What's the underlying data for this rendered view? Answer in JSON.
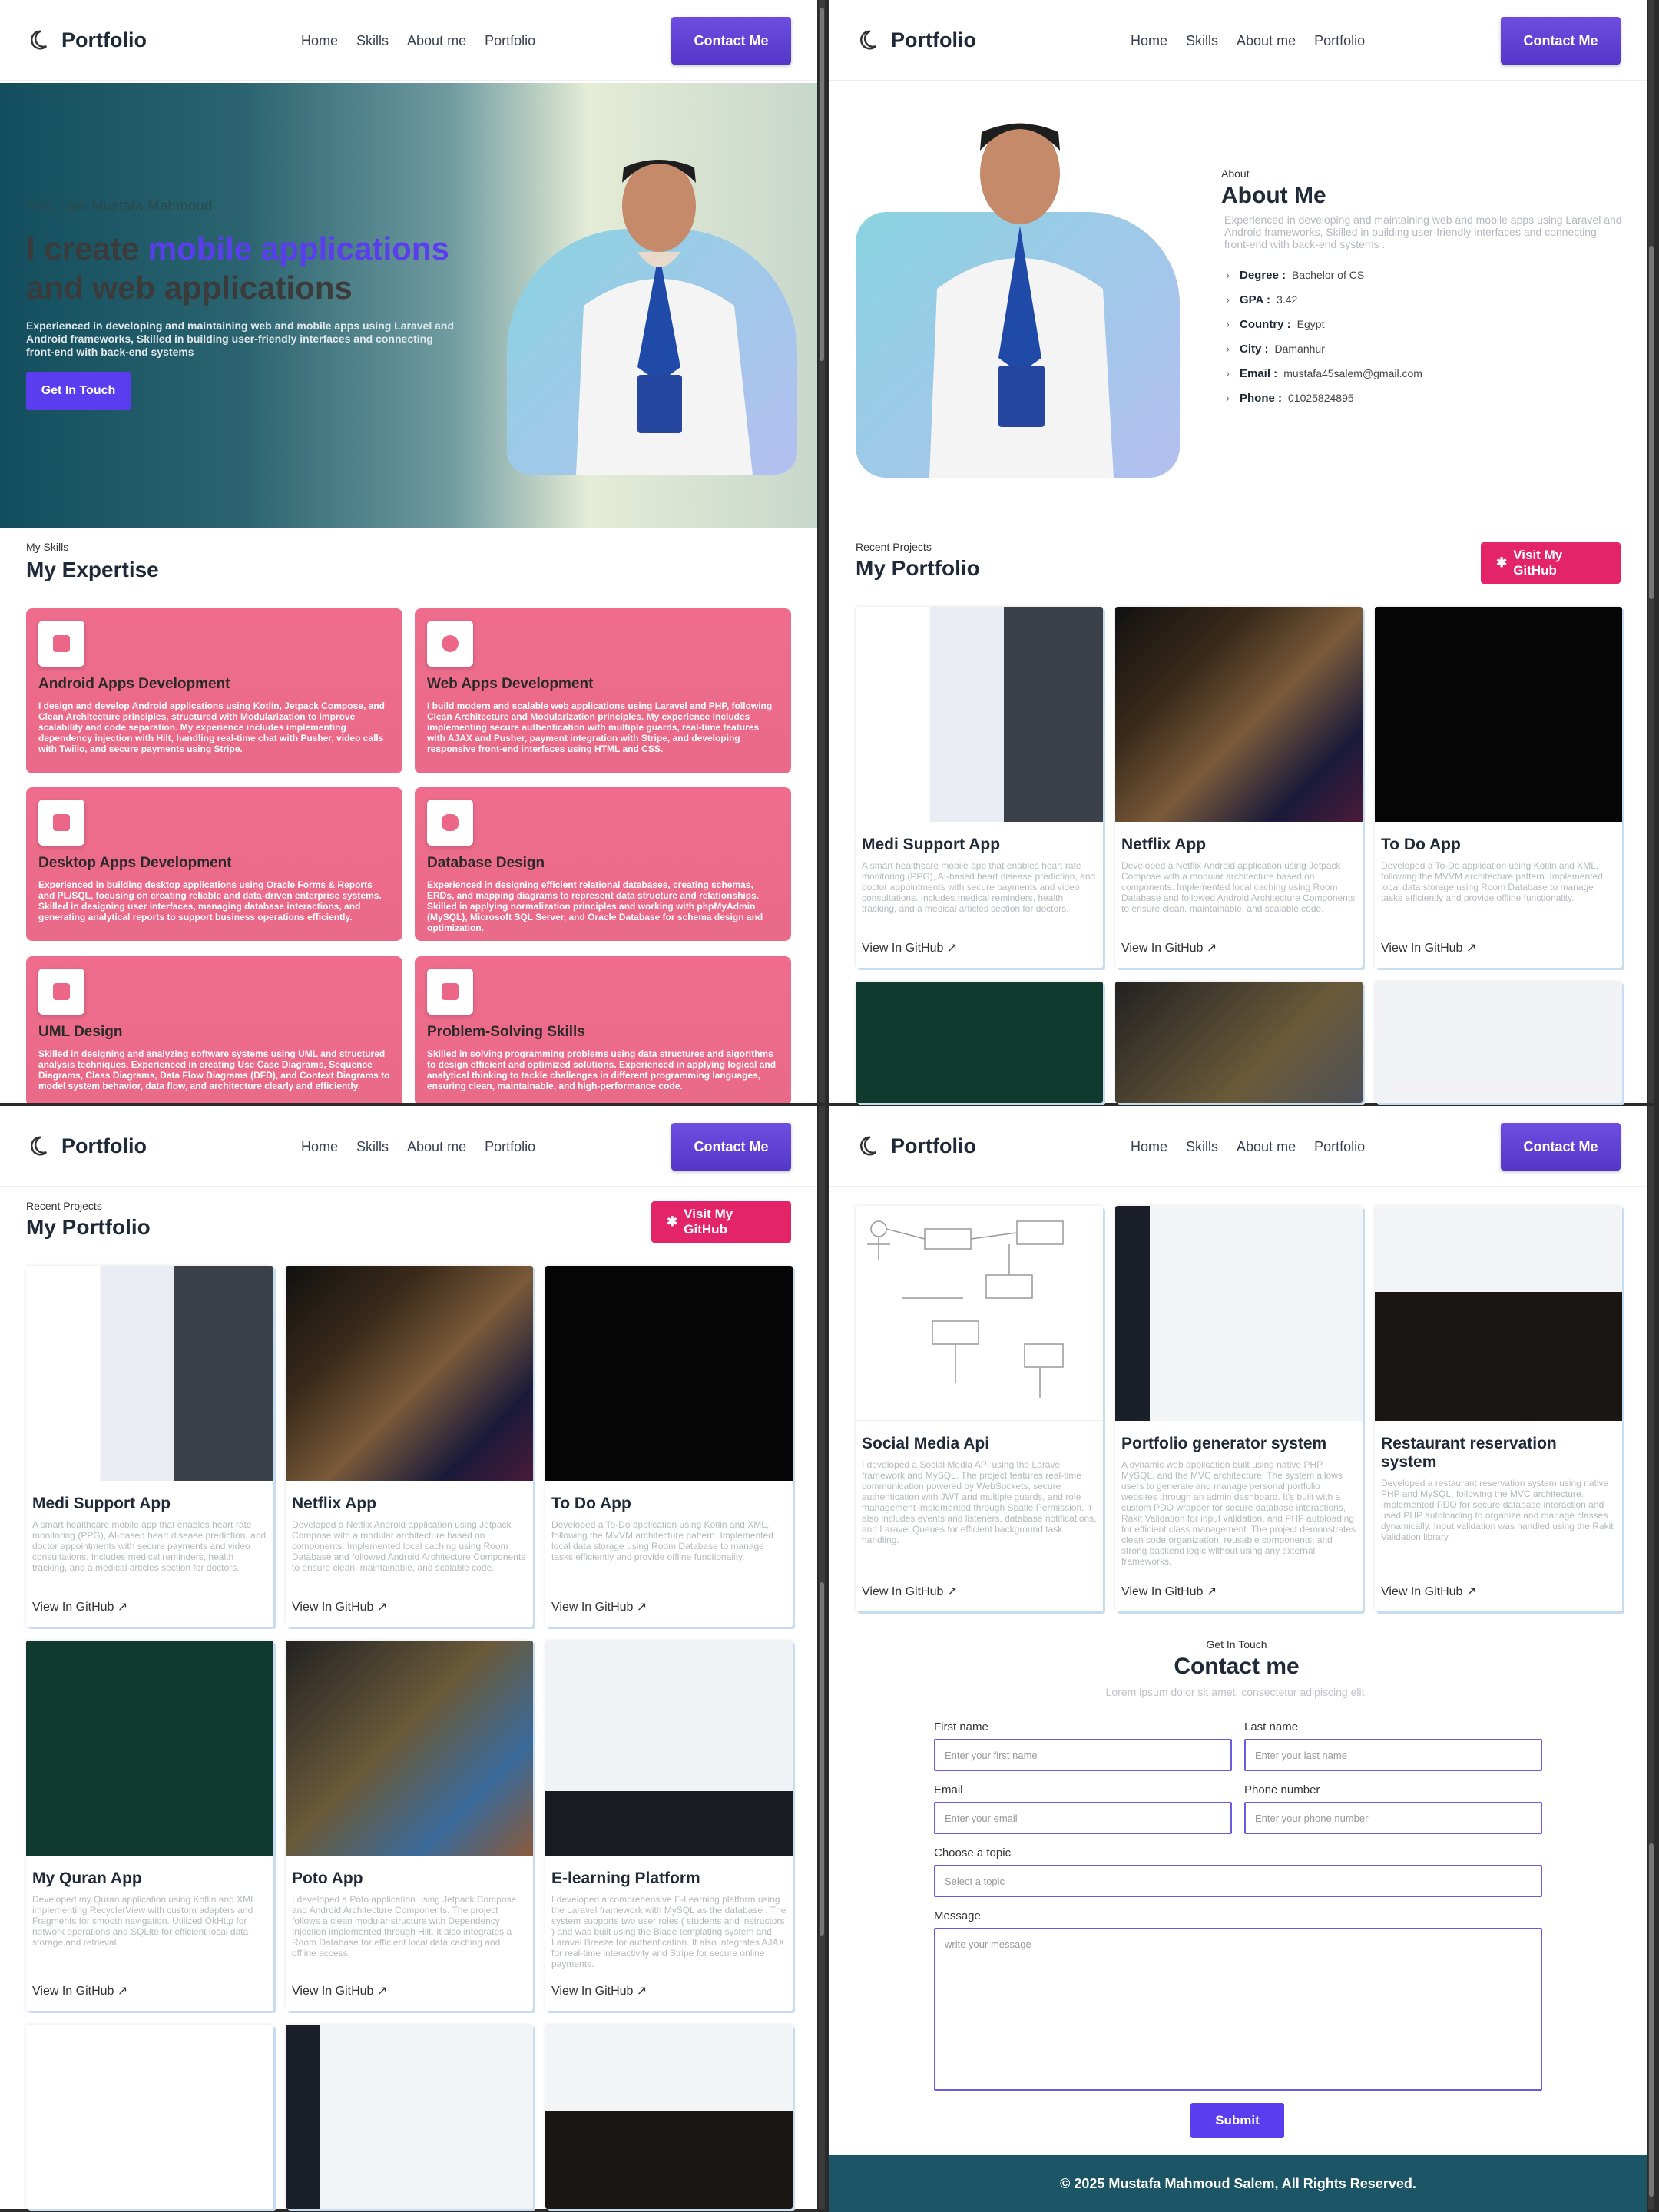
{
  "nav": {
    "brand": "Portfolio",
    "links": [
      "Home",
      "Skills",
      "About me",
      "Portfolio"
    ],
    "contact": "Contact Me"
  },
  "hero": {
    "greeting": "Hey, I am Mustafa Mahmoud",
    "line1": "I create ",
    "accent": "mobile applications",
    "line2": "and web applications",
    "desc": "Experienced in developing and maintaining web and mobile apps using Laravel and Android frameworks, Skilled in building user-friendly interfaces and connecting front-end with back-end systems",
    "cta": "Get In Touch"
  },
  "skills": {
    "eyebrow": "My Skills",
    "title": "My Expertise",
    "items": [
      {
        "title": "Android Apps Development",
        "icon": "mobile-icon",
        "desc": "I design and develop Android applications using Kotlin, Jetpack Compose, and Clean Architecture principles, structured with Modularization to improve scalability and code separation. My experience includes implementing dependency injection with Hilt, handling real-time chat with Pusher, video calls with Twilio, and secure payments using Stripe."
      },
      {
        "title": "Web Apps Development",
        "icon": "globe-icon",
        "desc": "I build modern and scalable web applications using Laravel and PHP, following Clean Architecture and Modularization principles. My experience includes implementing secure authentication with multiple guards, real-time features with AJAX and Pusher, payment integration with Stripe, and developing responsive front-end interfaces using HTML and CSS."
      },
      {
        "title": "Desktop Apps Development",
        "icon": "desktop-icon",
        "desc": "Experienced in building desktop applications using Oracle Forms & Reports and PL/SQL, focusing on creating reliable and data-driven enterprise systems. Skilled in designing user interfaces, managing database interactions, and generating analytical reports to support business operations efficiently."
      },
      {
        "title": "Database Design",
        "icon": "database-icon",
        "desc": "Experienced in designing efficient relational databases, creating schemas, ERDs, and mapping diagrams to represent data structure and relationships. Skilled in applying normalization principles and working with phpMyAdmin (MySQL), Microsoft SQL Server, and Oracle Database for schema design and optimization."
      },
      {
        "title": "UML Design",
        "icon": "diagram-icon",
        "desc": "Skilled in designing and analyzing software systems using UML and structured analysis techniques. Experienced in creating Use Case Diagrams, Sequence Diagrams, Class Diagrams, Data Flow Diagrams (DFD), and Context Diagrams to model system behavior, data flow, and architecture clearly and efficiently."
      },
      {
        "title": "Problem-Solving Skills",
        "icon": "puzzle-icon",
        "desc": "Skilled in solving programming problems using data structures and algorithms to design efficient and optimized solutions. Experienced in applying logical and analytical thinking to tackle challenges in different programming languages, ensuring clean, maintainable, and high-performance code."
      }
    ]
  },
  "about": {
    "eyebrow": "About",
    "title": "About Me",
    "desc": "Experienced in developing and maintaining web and mobile apps using Laravel and Android frameworks, Skilled in building user-friendly interfaces and connecting front-end with back-end systems .",
    "facts": [
      {
        "k": "Degree :",
        "v": "Bachelor of CS"
      },
      {
        "k": "GPA :",
        "v": "3.42"
      },
      {
        "k": "Country :",
        "v": "Egypt"
      },
      {
        "k": "City :",
        "v": "Damanhur"
      },
      {
        "k": "Email :",
        "v": "mustafa45salem@gmail.com"
      },
      {
        "k": "Phone :",
        "v": "01025824895"
      }
    ]
  },
  "portfolio": {
    "eyebrow": "Recent Projects",
    "title": "My Portfolio",
    "github_button": "Visit My GitHub",
    "link_label": "View In GitHub ↗",
    "projects": [
      {
        "title": "Medi Support App",
        "desc": "A smart healthcare mobile app that enables heart rate monitoring (PPG), AI-based heart disease prediction, and doctor appointments with secure payments and video consultations. Includes medical reminders, health tracking, and a medical articles section for doctors."
      },
      {
        "title": "Netflix App",
        "desc": "Developed a Netflix Android application using Jetpack Compose with a modular architecture based on components. Implemented local caching using Room Database and followed Android Architecture Components to ensure clean, maintainable, and scalable code."
      },
      {
        "title": "To Do App",
        "desc": "Developed a To-Do application using Kotlin and XML, following the MVVM architecture pattern. Implemented local data storage using Room Database to manage tasks efficiently and provide offline functionality."
      },
      {
        "title": "My Quran App",
        "desc": "Developed my Quran application using Kotlin and XML, implementing RecyclerView with custom adapters and Fragments for smooth navigation. Utilized OkHttp for network operations and SQLite for efficient local data storage and retrieval."
      },
      {
        "title": "Poto App",
        "desc": "I developed a Poto application using Jetpack Compose and Android Architecture Components. The project follows a clean modular structure with Dependency Injection implemented through Hilt. It also integrates a Room Database for efficient local data caching and offline access."
      },
      {
        "title": "E-learning Platform",
        "desc": "I developed a comprehensive E-Learning platform using the Laravel framework with MySQL as the database . The system supports two user roles ( students and instructors ) and was built using the Blade templating system and Laravel Breeze for authentication. It also integrates AJAX for real-time interactivity and Stripe for secure online payments."
      },
      {
        "title": "Social Media Api",
        "desc": "I developed a Social Media API using the Laravel framework and MySQL. The project features real-time communication powered by WebSockets, secure authentication with JWT and multiple guards, and role management implemented through Spatie Permission. It also includes events and listeners, database notifications, and Laravel Queues for efficient background task handling."
      },
      {
        "title": "Portfolio generator system",
        "desc": "A dynamic web application built using native PHP, MySQL, and the MVC architecture. The system allows users to generate and manage personal portfolio websites through an admin dashboard. It's built with a custom PDO wrapper for secure database interactions, Rakit Validation for input validation, and PHP autoloading for efficient class management. The project demonstrates clean code organization, reusable components, and strong backend logic without using any external frameworks."
      },
      {
        "title": "Restaurant reservation system",
        "desc": "Developed a restaurant reservation system using native PHP and MySQL, following the MVC architecture. Implemented PDO for secure database interaction and used PHP autoloading to organize and manage classes dynamically. Input validation was handled using the Rakit Validation library."
      }
    ]
  },
  "contact": {
    "eyebrow": "Get In Touch",
    "title": "Contact me",
    "subtitle": "Lorem ipsum dolor sit amet, consectetur adipiscing elit.",
    "first_label": "First name",
    "first_ph": "Enter your first name",
    "last_label": "Last name",
    "last_ph": "Enter your last name",
    "email_label": "Email",
    "email_ph": "Enter your email",
    "phone_label": "Phone number",
    "phone_ph": "Enter your phone number",
    "topic_label": "Choose a topic",
    "topic_ph": "Select a topic",
    "message_label": "Message",
    "message_ph": "write your message",
    "submit": "Submit"
  },
  "footer": {
    "text": "© 2025 Mustafa Mahmoud Salem, All Rights Reserved."
  },
  "colors": {
    "accent": "#5b3df0",
    "skill_card": "#ec6a8a",
    "github": "#e32468",
    "footer": "#1b5566"
  }
}
